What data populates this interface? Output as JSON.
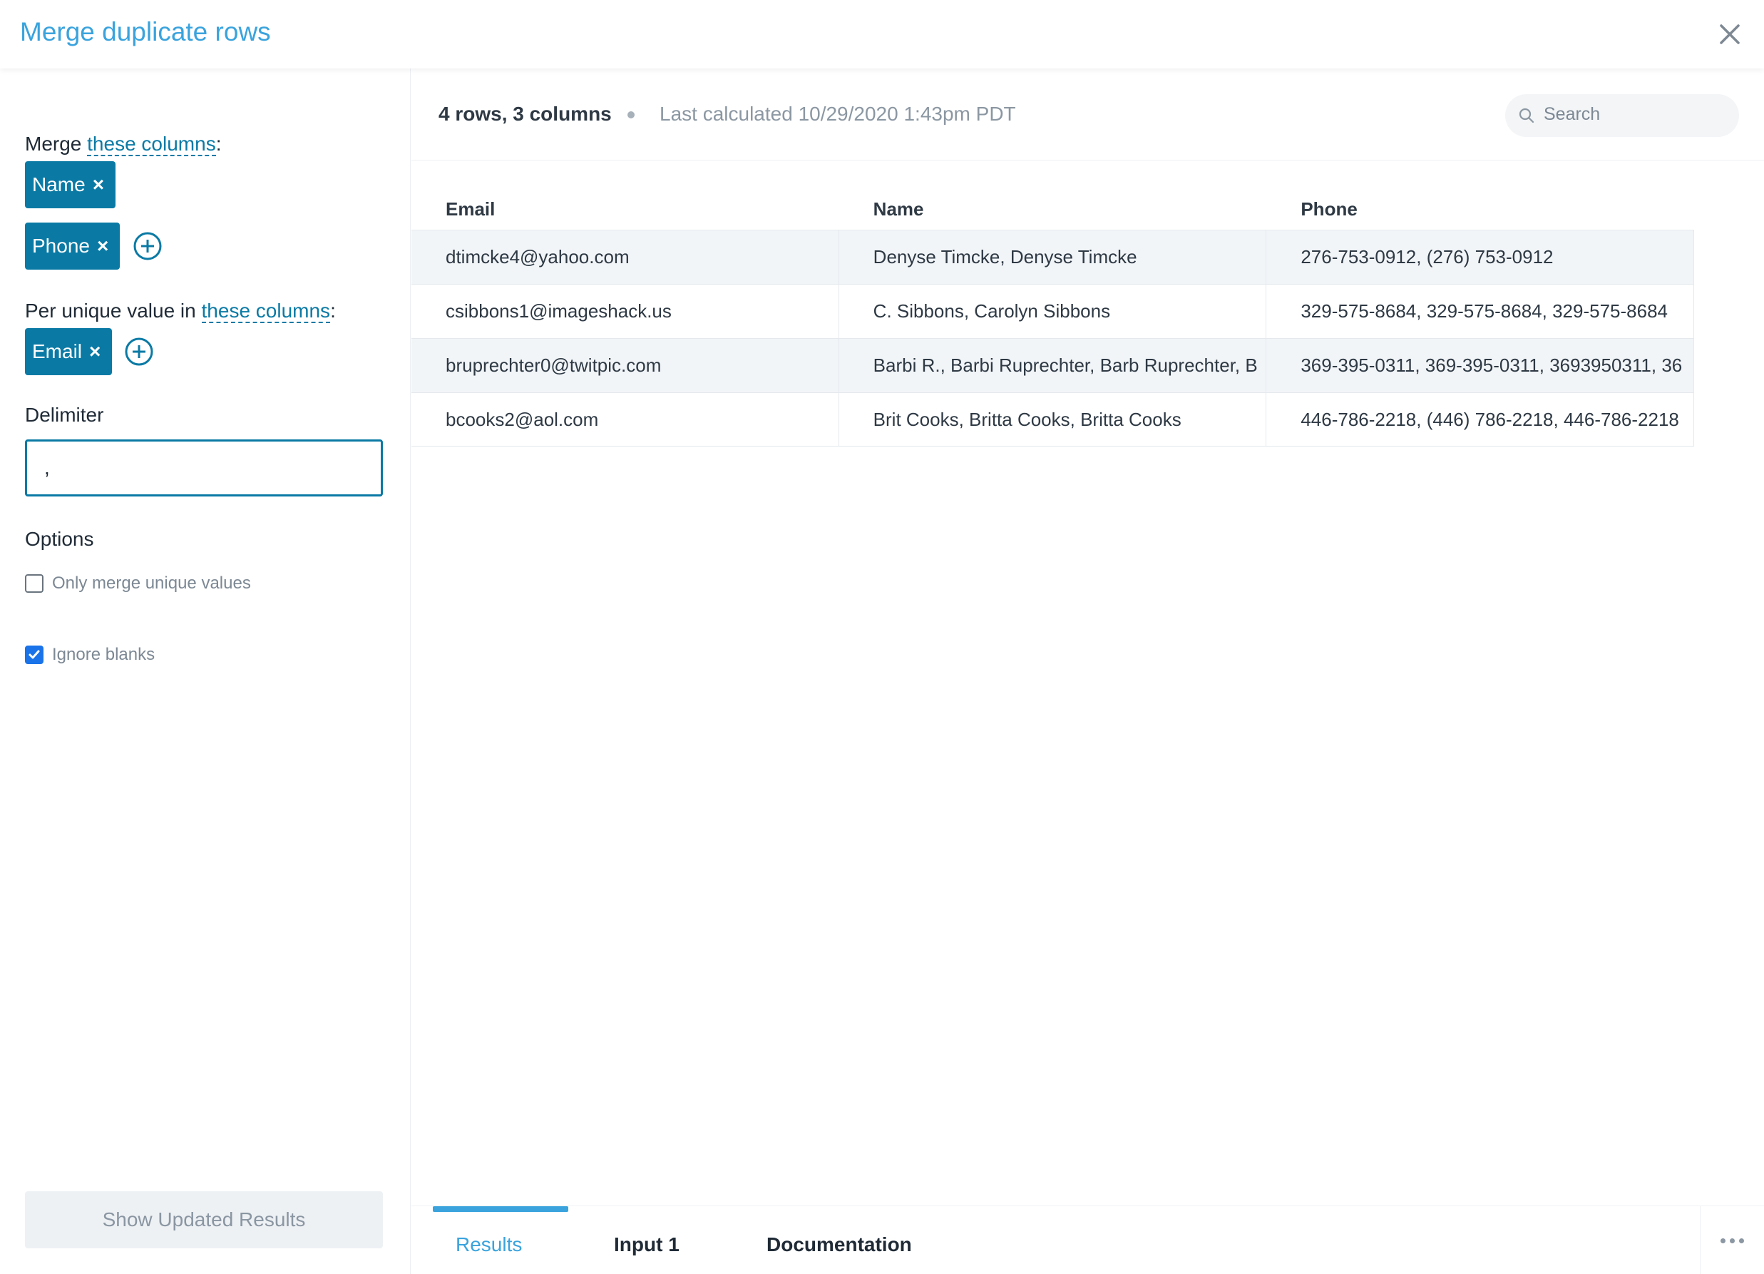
{
  "header": {
    "title": "Merge duplicate rows"
  },
  "sidebar": {
    "merge_prefix": "Merge ",
    "merge_link": "these columns",
    "merge_suffix": ":",
    "merge_tags": [
      "Name",
      "Phone"
    ],
    "per_prefix": "Per unique value in ",
    "per_link": "these columns",
    "per_suffix": ":",
    "per_tags": [
      "Email"
    ],
    "delimiter_label": "Delimiter",
    "delimiter_value": ",",
    "options_label": "Options",
    "options": [
      {
        "label": "Only merge unique values",
        "checked": false
      },
      {
        "label": "Ignore blanks",
        "checked": true
      }
    ],
    "show_button": "Show Updated Results"
  },
  "main": {
    "summary": "4 rows, 3 columns",
    "last_calculated": "Last calculated 10/29/2020 1:43pm PDT",
    "search_placeholder": "Search",
    "columns": [
      "Email",
      "Name",
      "Phone"
    ],
    "rows": [
      [
        "dtimcke4@yahoo.com",
        "Denyse Timcke, Denyse Timcke",
        "276-753-0912, (276) 753-0912"
      ],
      [
        "csibbons1@imageshack.us",
        "C. Sibbons, Carolyn Sibbons",
        "329-575-8684, 329-575-8684, 329-575-8684"
      ],
      [
        "bruprechter0@twitpic.com",
        "Barbi R., Barbi Ruprechter, Barb Ruprechter, B",
        "369-395-0311, 369-395-0311, 3693950311, 36"
      ],
      [
        "bcooks2@aol.com",
        "Brit Cooks, Britta Cooks, Britta Cooks",
        "446-786-2218, (446) 786-2218, 446-786-2218"
      ]
    ]
  },
  "footer": {
    "tabs": [
      "Results",
      "Input 1",
      "Documentation"
    ],
    "active_tab": "Results"
  },
  "colors": {
    "accent": "#3aa3dd",
    "tag": "#0a7aa5",
    "checkbox": "#1a73e8"
  },
  "icons": {
    "close": "close-icon",
    "add": "plus-circle-icon",
    "search": "search-icon",
    "more": "more-horizontal-icon"
  }
}
